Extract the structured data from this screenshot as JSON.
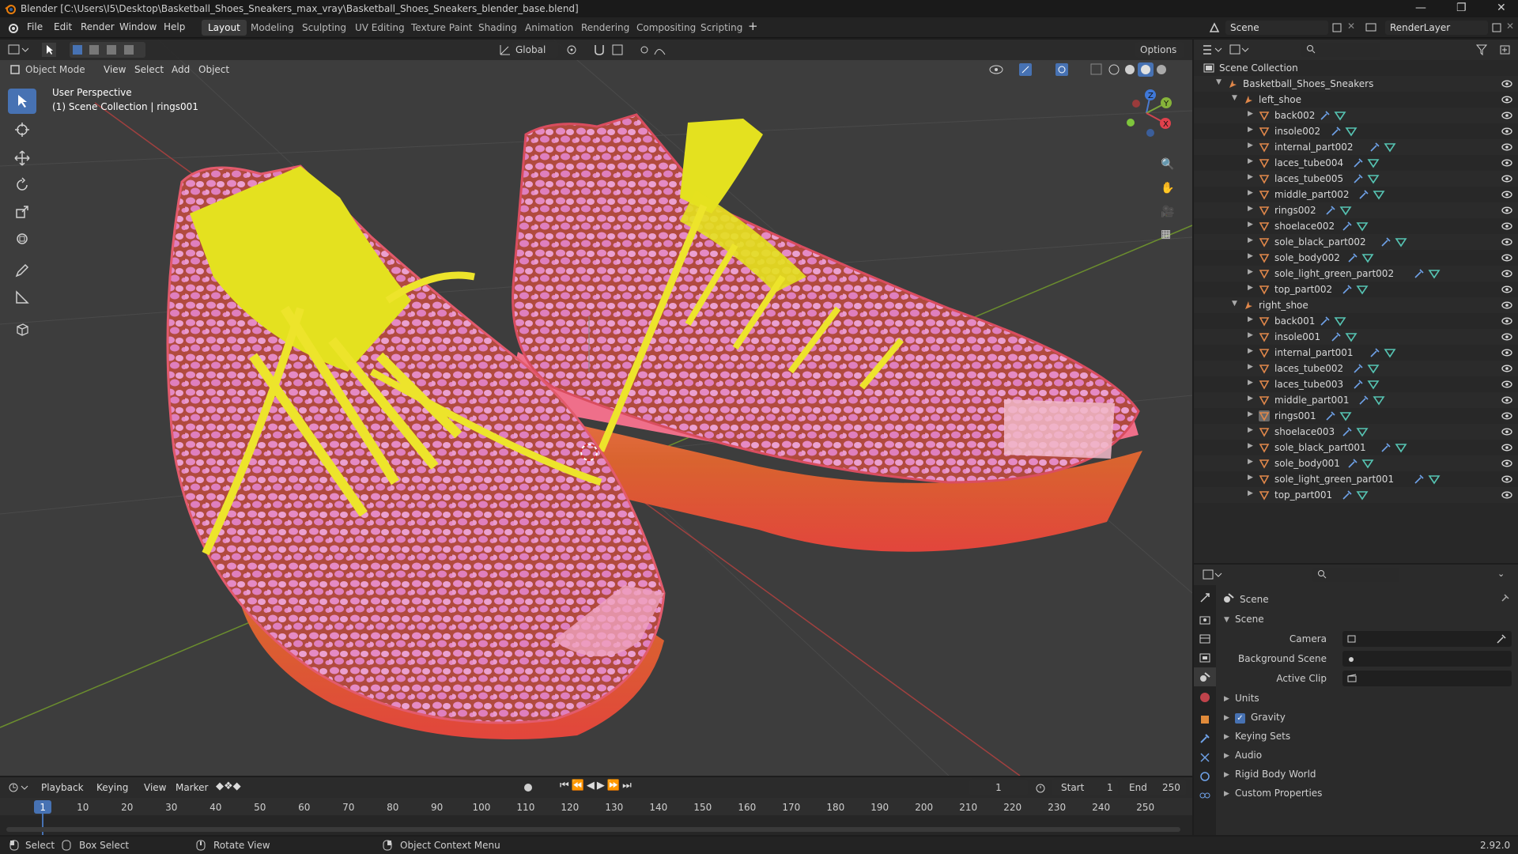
{
  "window": {
    "title": "Blender [C:\\Users\\I5\\Desktop\\Basketball_Shoes_Sneakers_max_vray\\Basketball_Shoes_Sneakers_blender_base.blend]"
  },
  "menu": [
    "File",
    "Edit",
    "Render",
    "Window",
    "Help"
  ],
  "workspaces": [
    "Layout",
    "Modeling",
    "Sculpting",
    "UV Editing",
    "Texture Paint",
    "Shading",
    "Animation",
    "Rendering",
    "Compositing",
    "Scripting"
  ],
  "active_workspace": "Layout",
  "scene_field": "Scene",
  "view_layer_field": "RenderLayer",
  "viewport": {
    "mode": "Object Mode",
    "menus": [
      "View",
      "Select",
      "Add",
      "Object"
    ],
    "transform_orientation": "Global",
    "options_label": "Options",
    "perspective_label": "User Perspective",
    "collection_label": "(1) Scene Collection | rings001",
    "gizmo_axes": [
      "Z",
      "Y",
      "X"
    ]
  },
  "outliner": {
    "root": "Scene Collection",
    "collection": "Basketball_Shoes_Sneakers",
    "groups": [
      {
        "name": "left_shoe",
        "items": [
          "back002",
          "insole002",
          "internal_part002",
          "laces_tube004",
          "laces_tube005",
          "middle_part002",
          "rings002",
          "shoelace002",
          "sole_black_part002",
          "sole_body002",
          "sole_light_green_part002",
          "top_part002"
        ]
      },
      {
        "name": "right_shoe",
        "items": [
          "back001",
          "insole001",
          "internal_part001",
          "laces_tube002",
          "laces_tube003",
          "middle_part001",
          "rings001",
          "shoelace003",
          "sole_black_part001",
          "sole_body001",
          "sole_light_green_part001",
          "top_part001"
        ]
      }
    ],
    "active_item": "rings001"
  },
  "properties": {
    "context": "Scene",
    "panel": "Scene",
    "fields": [
      {
        "label": "Camera",
        "value": ""
      },
      {
        "label": "Background Scene",
        "value": ""
      },
      {
        "label": "Active Clip",
        "value": ""
      }
    ],
    "subpanels": [
      "Units",
      "Gravity",
      "Keying Sets",
      "Audio",
      "Rigid Body World",
      "Custom Properties"
    ],
    "gravity_checked": true
  },
  "timeline": {
    "menus": [
      "Playback",
      "Keying",
      "View",
      "Marker"
    ],
    "current_frame": "1",
    "start_label": "Start",
    "start_value": "1",
    "end_label": "End",
    "end_value": "250",
    "ticks": [
      "1",
      "10",
      "20",
      "30",
      "40",
      "50",
      "60",
      "70",
      "80",
      "90",
      "100",
      "110",
      "120",
      "130",
      "140",
      "150",
      "160",
      "170",
      "180",
      "190",
      "200",
      "210",
      "220",
      "230",
      "240",
      "250"
    ]
  },
  "statusbar": {
    "select": "Select",
    "box_select": "Box Select",
    "rotate_view": "Rotate View",
    "context_menu": "Object Context Menu",
    "version": "2.92.0"
  },
  "colors": {
    "accent": "#4772b3",
    "mesh_icon": "#e0874a",
    "modifier_icon": "#6fa2e8",
    "data_icon": "#56c4b3",
    "shoe_pink": "#e4568e",
    "shoe_yellow": "#e6e21a"
  }
}
